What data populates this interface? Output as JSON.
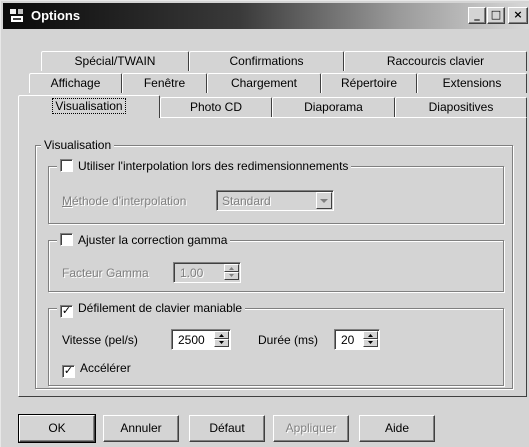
{
  "window": {
    "title": "Options",
    "controls": {
      "minimize": "_",
      "maximize": "□",
      "close": "×"
    }
  },
  "tabs": {
    "row1": [
      "Spécial/TWAIN",
      "Confirmations",
      "Raccourcis clavier"
    ],
    "row2": [
      "Affichage",
      "Fenêtre",
      "Chargement",
      "Répertoire",
      "Extensions"
    ],
    "row3": [
      "Visualisation",
      "Photo CD",
      "Diaporama",
      "Diapositives"
    ],
    "active": "Visualisation"
  },
  "visualisation": {
    "group_title": "Visualisation",
    "interpolation": {
      "checkbox_label": "Utiliser l'interpolation lors des redimensionnements",
      "checked": false,
      "method_label": "Méthode d'interpolation",
      "method_value": "Standard"
    },
    "gamma": {
      "checkbox_label": "Ajuster la correction gamma",
      "checked": false,
      "factor_label": "Facteur Gamma",
      "factor_value": "1.00"
    },
    "scroll": {
      "checkbox_label": "Défilement de clavier maniable",
      "checked": true,
      "speed_label": "Vitesse (pel/s)",
      "speed_value": "2500",
      "duration_label": "Durée (ms)",
      "duration_value": "20",
      "accelerate_label": "Accélérer",
      "accelerate_checked": true
    }
  },
  "buttons": {
    "ok": "OK",
    "cancel": "Annuler",
    "default": "Défaut",
    "apply": "Appliquer",
    "help": "Aide"
  },
  "colors": {
    "face": "#d4d4d4",
    "titlebar_start": "#0a0a0a",
    "titlebar_end": "#d8d8d8",
    "disabled_text": "#808080"
  },
  "icons": {
    "app": "options-app-icon",
    "checkmark": "checkmark-icon",
    "dropdown": "chevron-down-icon",
    "spin_up": "arrow-up-icon",
    "spin_down": "arrow-down-icon"
  }
}
